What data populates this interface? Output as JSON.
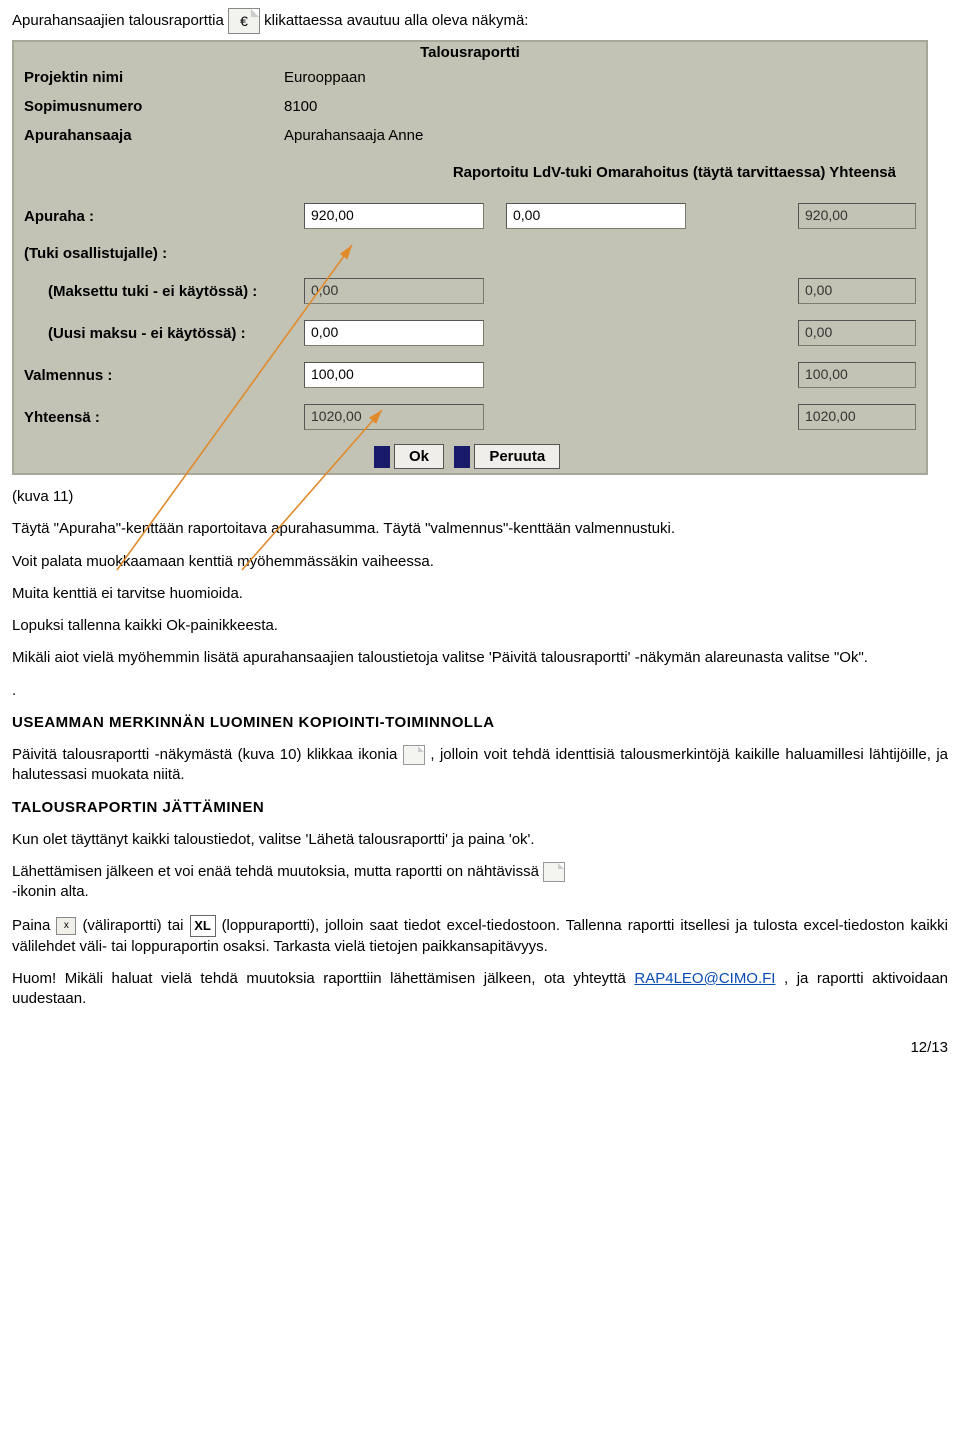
{
  "intro": {
    "before_icon": "Apurahansaajien talousraporttia ",
    "euro_glyph": "€",
    "after_icon": " klikattaessa avautuu alla oleva näkymä:"
  },
  "panel": {
    "title": "Talousraportti",
    "meta": {
      "proj_label": "Projektin nimi",
      "proj_val": "Eurooppaan",
      "num_label": "Sopimusnumero",
      "num_val": "8100",
      "recip_label": "Apurahansaaja",
      "recip_val": "Apurahansaaja Anne"
    },
    "columns_header": "Raportoitu LdV-tuki Omarahoitus (täytä tarvittaessa) Yhteensä",
    "rows": {
      "apuraha_label": "Apuraha :",
      "apuraha_v1": "920,00",
      "apuraha_v2": "0,00",
      "apuraha_total": "920,00",
      "tuki_label": "(Tuki osallistujalle) :",
      "maksettu_label": "(Maksettu tuki - ei käytössä) :",
      "maksettu_v1": "0,00",
      "maksettu_total": "0,00",
      "uusi_label": "(Uusi maksu - ei käytössä) :",
      "uusi_v1": "0,00",
      "uusi_total": "0,00",
      "valmennus_label": "Valmennus :",
      "valmennus_v1": "100,00",
      "valmennus_total": "100,00",
      "yht_label": "Yhteensä :",
      "yht_v1": "1020,00",
      "yht_total": "1020,00"
    },
    "buttons": {
      "ok": "Ok",
      "cancel": "Peruuta"
    }
  },
  "body": {
    "kuva": "(kuva 11)",
    "p1": "Täytä \"Apuraha\"-kenttään raportoitava apurahasumma. Täytä \"valmennus\"-kenttään valmennustuki.",
    "p2": "Voit palata muokkaamaan kenttiä myöhemmässäkin vaiheessa.",
    "p3": "Muita kenttiä ei tarvitse huomioida.",
    "p4": "Lopuksi tallenna kaikki Ok-painikkeesta.",
    "p5": "Mikäli aiot vielä myöhemmin lisätä apurahansaajien taloustietoja valitse 'Päivitä talousraportti' -näkymän alareunasta valitse \"Ok\".",
    "dot": ".",
    "h1": "USEAMMAN MERKINNÄN LUOMINEN KOPIOINTI-TOIMINNOLLA",
    "p6a": "Päivitä talousraportti -näkymästä (kuva 10) klikkaa ikonia ",
    "p6b": ", jolloin voit tehdä identtisiä talousmerkintöjä kaikille haluamillesi lähtijöille, ja halutessasi muokata niitä.",
    "h2": "TALOUSRAPORTIN JÄTTÄMINEN",
    "p7": "Kun olet täyttänyt kaikki taloustiedot, valitse 'Lähetä talousraportti' ja paina 'ok'.",
    "p8a": "Lähettämisen jälkeen et voi enää tehdä muutoksia, mutta raportti on nähtävissä ",
    "p8b": " -ikonin alta.",
    "p9a": "Paina ",
    "p9b": " (väliraportti) tai ",
    "p9c": " (loppuraportti), jolloin saat tiedot excel-tiedostoon.",
    "p10": " Tallenna raportti itsellesi ja tulosta excel-tiedoston kaikki välilehdet väli- tai loppuraportin osaksi. Tarkasta vielä tietojen paikkansapitävyys.",
    "p11a": "Huom! Mikäli haluat vielä tehdä muutoksia raporttiin lähettämisen jälkeen, ota yhteyttä ",
    "link_text": "RAP4LEO@CIMO.FI",
    "p11b": ", ja raportti aktivoidaan uudestaan.",
    "xl_label": "XL",
    "pager": "12/13"
  }
}
